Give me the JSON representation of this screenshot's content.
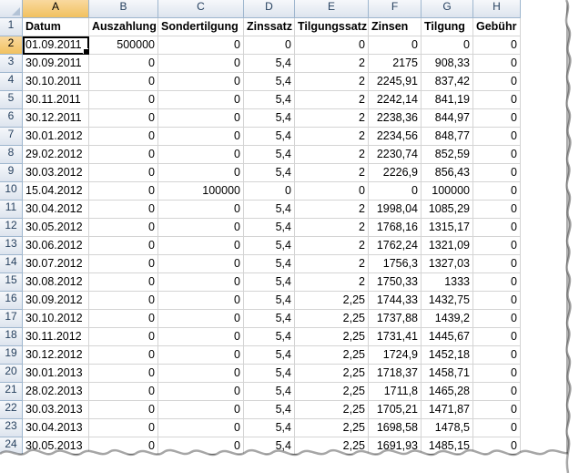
{
  "sheet": {
    "column_letters": [
      "A",
      "B",
      "C",
      "D",
      "E",
      "F",
      "G",
      "H"
    ],
    "selected_cell": "A2",
    "header_row": {
      "number": "1",
      "cells": [
        "Datum",
        "Auszahlung",
        "Sondertilgung",
        "Zinssatz",
        "Tilgungssatz",
        "Zinsen",
        "Tilgung",
        "Gebühr"
      ]
    },
    "rows": [
      {
        "number": "2",
        "cells": [
          "01.09.2011",
          "500000",
          "0",
          "0",
          "0",
          "0",
          "0",
          "0"
        ]
      },
      {
        "number": "3",
        "cells": [
          "30.09.2011",
          "0",
          "0",
          "5,4",
          "2",
          "2175",
          "908,33",
          "0"
        ]
      },
      {
        "number": "4",
        "cells": [
          "30.10.2011",
          "0",
          "0",
          "5,4",
          "2",
          "2245,91",
          "837,42",
          "0"
        ]
      },
      {
        "number": "5",
        "cells": [
          "30.11.2011",
          "0",
          "0",
          "5,4",
          "2",
          "2242,14",
          "841,19",
          "0"
        ]
      },
      {
        "number": "6",
        "cells": [
          "30.12.2011",
          "0",
          "0",
          "5,4",
          "2",
          "2238,36",
          "844,97",
          "0"
        ]
      },
      {
        "number": "7",
        "cells": [
          "30.01.2012",
          "0",
          "0",
          "5,4",
          "2",
          "2234,56",
          "848,77",
          "0"
        ]
      },
      {
        "number": "8",
        "cells": [
          "29.02.2012",
          "0",
          "0",
          "5,4",
          "2",
          "2230,74",
          "852,59",
          "0"
        ]
      },
      {
        "number": "9",
        "cells": [
          "30.03.2012",
          "0",
          "0",
          "5,4",
          "2",
          "2226,9",
          "856,43",
          "0"
        ]
      },
      {
        "number": "10",
        "cells": [
          "15.04.2012",
          "0",
          "100000",
          "0",
          "0",
          "0",
          "100000",
          "0"
        ]
      },
      {
        "number": "11",
        "cells": [
          "30.04.2012",
          "0",
          "0",
          "5,4",
          "2",
          "1998,04",
          "1085,29",
          "0"
        ]
      },
      {
        "number": "12",
        "cells": [
          "30.05.2012",
          "0",
          "0",
          "5,4",
          "2",
          "1768,16",
          "1315,17",
          "0"
        ]
      },
      {
        "number": "13",
        "cells": [
          "30.06.2012",
          "0",
          "0",
          "5,4",
          "2",
          "1762,24",
          "1321,09",
          "0"
        ]
      },
      {
        "number": "14",
        "cells": [
          "30.07.2012",
          "0",
          "0",
          "5,4",
          "2",
          "1756,3",
          "1327,03",
          "0"
        ]
      },
      {
        "number": "15",
        "cells": [
          "30.08.2012",
          "0",
          "0",
          "5,4",
          "2",
          "1750,33",
          "1333",
          "0"
        ]
      },
      {
        "number": "16",
        "cells": [
          "30.09.2012",
          "0",
          "0",
          "5,4",
          "2,25",
          "1744,33",
          "1432,75",
          "0"
        ]
      },
      {
        "number": "17",
        "cells": [
          "30.10.2012",
          "0",
          "0",
          "5,4",
          "2,25",
          "1737,88",
          "1439,2",
          "0"
        ]
      },
      {
        "number": "18",
        "cells": [
          "30.11.2012",
          "0",
          "0",
          "5,4",
          "2,25",
          "1731,41",
          "1445,67",
          "0"
        ]
      },
      {
        "number": "19",
        "cells": [
          "30.12.2012",
          "0",
          "0",
          "5,4",
          "2,25",
          "1724,9",
          "1452,18",
          "0"
        ]
      },
      {
        "number": "20",
        "cells": [
          "30.01.2013",
          "0",
          "0",
          "5,4",
          "2,25",
          "1718,37",
          "1458,71",
          "0"
        ]
      },
      {
        "number": "21",
        "cells": [
          "28.02.2013",
          "0",
          "0",
          "5,4",
          "2,25",
          "1711,8",
          "1465,28",
          "0"
        ]
      },
      {
        "number": "22",
        "cells": [
          "30.03.2013",
          "0",
          "0",
          "5,4",
          "2,25",
          "1705,21",
          "1471,87",
          "0"
        ]
      },
      {
        "number": "23",
        "cells": [
          "30.04.2013",
          "0",
          "0",
          "5,4",
          "2,25",
          "1698,58",
          "1478,5",
          "0"
        ]
      },
      {
        "number": "24",
        "cells": [
          "30.05.2013",
          "0",
          "0",
          "5,4",
          "2,25",
          "1691,93",
          "1485,15",
          "0"
        ]
      }
    ]
  },
  "colors": {
    "gridline": "#d4d4d4",
    "header_text": "#27415f",
    "active_header": "#f1c15f",
    "selection_border": "#000000"
  }
}
